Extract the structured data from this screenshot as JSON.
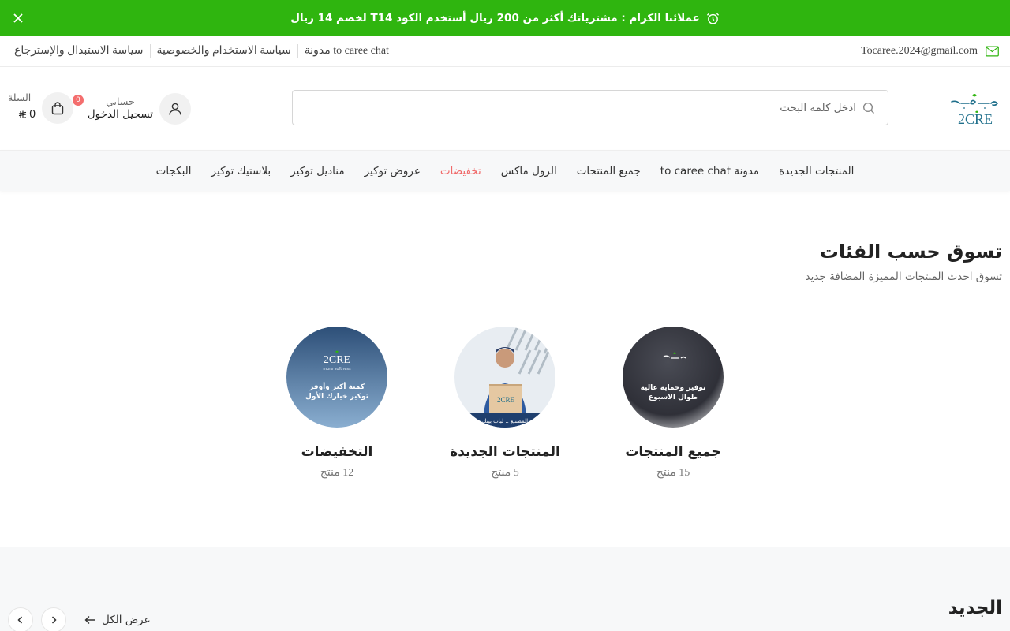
{
  "promo": {
    "text": "عملائنا الكرام : مشترياتك أكثر من 200 ريال أستخدم الكود T14 لخصم 14 ريال",
    "bg_color": "#2fb50f"
  },
  "utility": {
    "email": "Tocaree.2024@gmail.com",
    "links": [
      "سياسة الاستبدال والإسترجاع",
      "سياسة الاستخدام والخصوصية",
      "مدونة to caree chat"
    ]
  },
  "header": {
    "search_placeholder": "ادخل كلمة البحث",
    "account_label": "حسابي",
    "login_label": "تسجيل الدخول",
    "cart_label": "السلة",
    "cart_count": "0",
    "cart_total": "0",
    "currency_icon": "riyal-icon"
  },
  "nav": {
    "items": [
      "المنتجات الجديدة",
      "مدونة to caree chat",
      "جميع المنتجات",
      "الرول ماكس",
      "تخفيضات",
      "عروض توكير",
      "مناديل توكير",
      "بلاستيك توكير",
      "البكجات"
    ],
    "active_color": "#f06a6a"
  },
  "categories": {
    "title": "تسوق حسب الفئات",
    "subtitle": "تسوق احدث المنتجات المميزة المضافة جديد",
    "items": [
      {
        "name": "جميع المنتجات",
        "count": "15 منتج",
        "image_text": [
          "توفير وحماية عالية",
          "طوال الاسبوع"
        ]
      },
      {
        "name": "المنتجات الجديدة",
        "count": "5 منتج",
        "image_text": [
          "المصنـع .. لباب بيتك"
        ]
      },
      {
        "name": "التخفيضات",
        "count": "12 منتج",
        "image_text": [
          "كمية أكبر وأوفر",
          "توكير خيارك الأول"
        ]
      }
    ]
  },
  "new_products": {
    "title": "الجديد",
    "view_all": "عرض الكل"
  },
  "brand": {
    "green": "#2fb50f",
    "teal": "#1f6f8b"
  }
}
